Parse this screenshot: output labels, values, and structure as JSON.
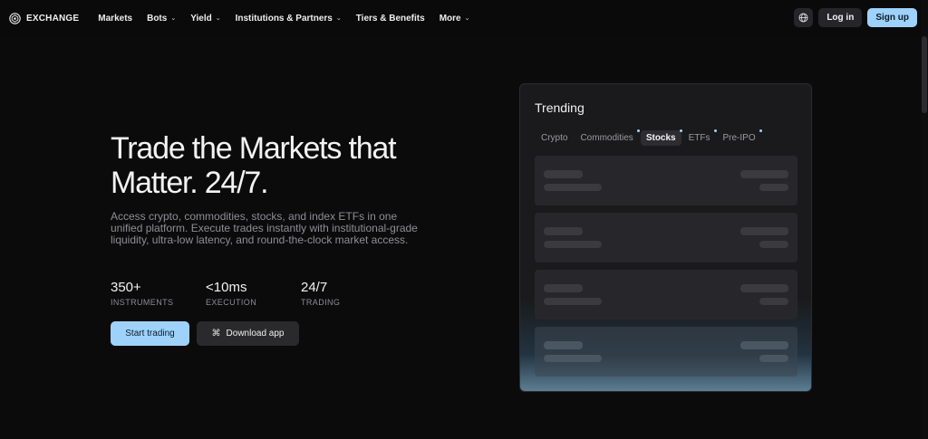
{
  "nav": {
    "brand": "EXCHANGE",
    "items": [
      {
        "label": "Markets",
        "chevron": false
      },
      {
        "label": "Bots",
        "chevron": true
      },
      {
        "label": "Yield",
        "chevron": true
      },
      {
        "label": "Institutions & Partners",
        "chevron": true
      },
      {
        "label": "Tiers & Benefits",
        "chevron": false
      },
      {
        "label": "More",
        "chevron": true
      }
    ],
    "login_label": "Log in",
    "signup_label": "Sign up",
    "globe_icon": "globe-icon",
    "chevron_glyph": "⌄"
  },
  "hero": {
    "title": "Trade the Markets that Matter. 24/7.",
    "description": "Access crypto, commodities, stocks, and index ETFs in one unified platform. Execute trades instantly with institutional-grade liquidity, ultra-low latency, and round-the-clock market access.",
    "stats": [
      {
        "value": "350+",
        "label": "INSTRUMENTS"
      },
      {
        "value": "<10ms",
        "label": "EXECUTION"
      },
      {
        "value": "24/7",
        "label": "TRADING"
      }
    ],
    "start_label": "Start trading",
    "download_label": "Download app",
    "download_icon": "⌘"
  },
  "trending": {
    "title": "Trending",
    "tabs": [
      {
        "label": "Crypto",
        "dot": false,
        "active": false
      },
      {
        "label": "Commodities",
        "dot": true,
        "active": false
      },
      {
        "label": "Stocks",
        "dot": true,
        "active": true
      },
      {
        "label": "ETFs",
        "dot": true,
        "active": false
      },
      {
        "label": "Pre-IPO",
        "dot": true,
        "active": false
      }
    ],
    "row_count": 4
  },
  "colors": {
    "accent": "#9ed2fb",
    "background": "#0b0b0c",
    "card": "#1a1a1c",
    "muted_text": "#8e8e94"
  }
}
